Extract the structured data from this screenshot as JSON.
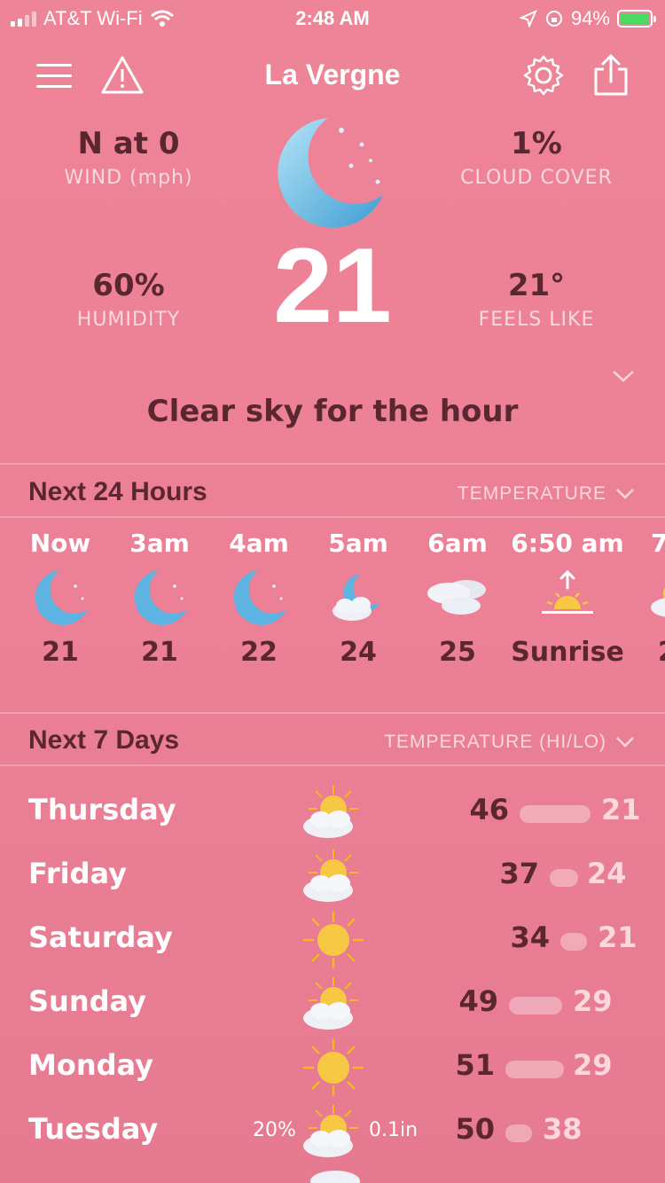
{
  "status": {
    "carrier": "AT&T Wi-Fi",
    "time": "2:48 AM",
    "battery": "94%"
  },
  "header": {
    "title": "La Vergne"
  },
  "current": {
    "wind_value": "N at 0",
    "wind_label": "WIND (mph)",
    "cloud_value": "1%",
    "cloud_label": "CLOUD COVER",
    "humidity_value": "60%",
    "humidity_label": "HUMIDITY",
    "feels_value": "21°",
    "feels_label": "FEELS LIKE",
    "temperature": "21",
    "summary": "Clear sky for the hour"
  },
  "hourly_section": {
    "title": "Next 24 Hours",
    "sort": "TEMPERATURE"
  },
  "hourly": [
    {
      "time": "Now",
      "value": "21",
      "icon": "moon-icon"
    },
    {
      "time": "3am",
      "value": "21",
      "icon": "moon-icon"
    },
    {
      "time": "4am",
      "value": "22",
      "icon": "moon-icon"
    },
    {
      "time": "5am",
      "value": "24",
      "icon": "moon-cloud-icon"
    },
    {
      "time": "6am",
      "value": "25",
      "icon": "cloudy-icon"
    },
    {
      "time": "6:50 am",
      "value": "Sunrise",
      "icon": "sunrise-icon"
    },
    {
      "time": "7",
      "value": "2",
      "icon": "sun-cloud-icon"
    }
  ],
  "daily_section": {
    "title": "Next 7 Days",
    "sort": "TEMPERATURE (HI/LO)"
  },
  "daily": [
    {
      "day": "Thursday",
      "hi": "46",
      "lo": "21",
      "icon": "sun-cloud-icon",
      "precip": "",
      "amount": ""
    },
    {
      "day": "Friday",
      "hi": "37",
      "lo": "24",
      "icon": "sun-cloud-icon",
      "precip": "",
      "amount": ""
    },
    {
      "day": "Saturday",
      "hi": "34",
      "lo": "21",
      "icon": "sun-icon",
      "precip": "",
      "amount": ""
    },
    {
      "day": "Sunday",
      "hi": "49",
      "lo": "29",
      "icon": "sun-cloud-icon",
      "precip": "",
      "amount": ""
    },
    {
      "day": "Monday",
      "hi": "51",
      "lo": "29",
      "icon": "sun-icon",
      "precip": "",
      "amount": ""
    },
    {
      "day": "Tuesday",
      "hi": "50",
      "lo": "38",
      "icon": "sun-cloud-icon",
      "precip": "20%",
      "amount": "0.1in"
    }
  ]
}
